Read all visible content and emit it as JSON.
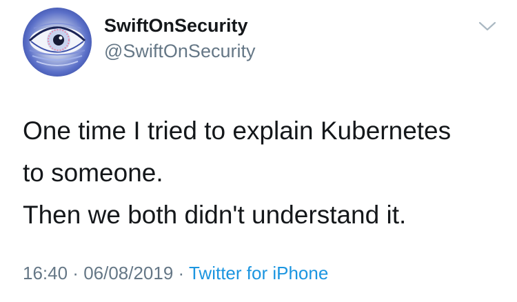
{
  "author": {
    "display_name": "SwiftOnSecurity",
    "handle": "@SwiftOnSecurity",
    "avatar_icon": "eye-avatar-icon"
  },
  "menu": {
    "icon": "chevron-down-icon"
  },
  "tweet": {
    "lines": [
      "One time I tried to explain Kubernetes",
      "to someone.",
      "Then we both didn't understand it."
    ]
  },
  "meta": {
    "time": "16:40",
    "separator": " · ",
    "date": "06/08/2019",
    "source": "Twitter for iPhone"
  },
  "colors": {
    "text": "#14171a",
    "secondary": "#657786",
    "link": "#1b95e0",
    "background": "#ffffff"
  }
}
